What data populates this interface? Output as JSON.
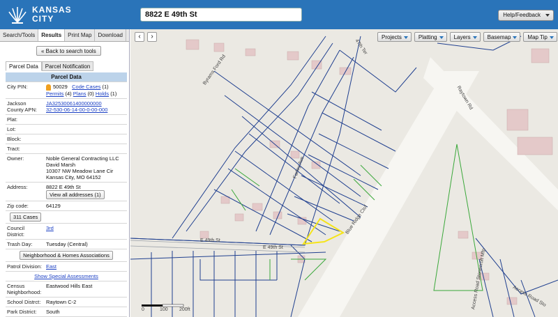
{
  "header": {
    "logo_line1": "KANSAS",
    "logo_line2": "CITY",
    "search_value": "8822 E 49th St",
    "help_label": "Help/Feedback"
  },
  "left_tabs": [
    "Search/Tools",
    "Results",
    "Print Map",
    "Download"
  ],
  "active_tab": "Results",
  "back_label": "« Back to search tools",
  "sub_tabs": [
    "Parcel Data",
    "Parcel Notification"
  ],
  "parcel": {
    "header": "Parcel Data",
    "city_pin_label": "City PIN:",
    "city_pin": "50029",
    "code_cases_link": "Code Cases",
    "code_cases_count": "(1)",
    "permits_link": "Permits",
    "permits_count": "(4)",
    "plans_link": "Plans",
    "plans_count": "(0)",
    "holds_link": "Holds",
    "holds_count": "(1)",
    "apn_label": "Jackson County APN:",
    "apn_1": "JA32530061400000000",
    "apn_2": "32-530-06-14-00-0-00-000",
    "plat_label": "Plat:",
    "lot_label": "Lot:",
    "block_label": "Block:",
    "tract_label": "Tract:",
    "owner_label": "Owner:",
    "owner_1": "Noble General Contracting LLC",
    "owner_2": "David Marsh",
    "owner_3": "10307 NW Meadow Lane Cir",
    "owner_4": "Kansas City, MO 64152",
    "address_label": "Address:",
    "address": "8822 E 49th St",
    "view_all_label": "View all addresses (1)",
    "zip_label": "Zip code:",
    "zip": "64129",
    "cases_button": "311 Cases",
    "council_label": "Council District:",
    "council": "3rd",
    "trash_label": "Trash Day:",
    "trash": "Tuesday (Central)",
    "nha_button": "Neighborhood & Homes Associations",
    "patrol_label": "Patrol Division:",
    "patrol": "East",
    "assessments_link": "Show Special Assessments",
    "census_label": "Census Neighborhood:",
    "census": "Eastwood Hills East",
    "school_label": "School Distrct:",
    "school": "Raytown C-2",
    "park_label": "Park District:",
    "park": "South"
  },
  "map": {
    "toolbar": [
      "Projects",
      "Platting",
      "Layers",
      "Basemap",
      "Map Tip"
    ],
    "labels": {
      "byrams_ford_rd": "Byrams Ford Rd",
      "farley_ave": "Farley Ave",
      "e49th_1": "E 49th St",
      "e49th_2": "E 49th St",
      "blue_ridge_cutoff": "Blue Ridge Ctof",
      "raytown_rd": "Raytown Rd",
      "access_road": "Access Road Stonecroft Mfp",
      "access_road_2": "Access Road Sto",
      "e47th_ter": "47th Ter"
    },
    "scale": [
      "0",
      "100",
      "200ft"
    ],
    "colors": {
      "parcel_line": "#1f3f8f",
      "selected_parcel": "#f5e41a",
      "green_boundary": "#3aa83a"
    }
  }
}
